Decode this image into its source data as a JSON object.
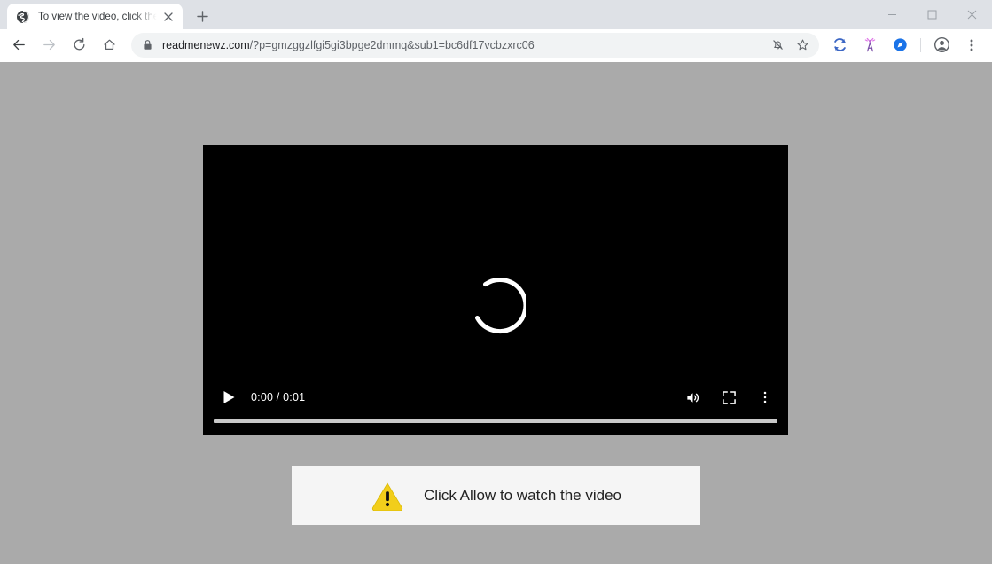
{
  "window": {
    "controls": [
      {
        "name": "minimize",
        "glyph": "minimize-icon"
      },
      {
        "name": "maximize",
        "glyph": "maximize-icon"
      },
      {
        "name": "close",
        "glyph": "close-icon"
      }
    ]
  },
  "tabstrip": {
    "tab": {
      "title": "To view the video, click the Allow",
      "favicon": "globe-icon",
      "close_label": "close-tab-icon"
    },
    "new_tab_label": "new-tab-icon"
  },
  "toolbar": {
    "back_label": "back-arrow-icon",
    "forward_label": "forward-arrow-icon",
    "reload_label": "reload-icon",
    "home_label": "home-icon",
    "lock_label": "lock-icon",
    "url_host": "readmenewz.com",
    "url_path": "/?p=gmzggzlfgi5gi3bpge2dmmq&sub1=bc6df17vcbzxrc06",
    "notifications_blocked_label": "bell-slash-icon",
    "bookmark_label": "star-icon",
    "extensions": [
      {
        "name": "sync-extension",
        "icon": "circular-arrows-icon",
        "color": "#3b66c4"
      },
      {
        "name": "antenna-extension",
        "icon": "antenna-tower-icon",
        "color": "#b06ad6"
      },
      {
        "name": "compass-extension",
        "icon": "compass-icon",
        "color": "#1a73e8"
      }
    ],
    "profile_label": "profile-avatar-icon",
    "menu_label": "chrome-menu-icon"
  },
  "page": {
    "background_color": "#aaaaaa",
    "video": {
      "background_color": "#000000",
      "spinner_label": "loading-spinner",
      "play_label": "play-icon",
      "time_current": "0:00",
      "time_separator": "/",
      "time_duration": "0:01",
      "time_display": "0:00 / 0:01",
      "volume_label": "volume-icon",
      "fullscreen_label": "fullscreen-icon",
      "more_options_label": "more-options-icon",
      "progress_percent": 0
    },
    "notice": {
      "icon": "warning-triangle-icon",
      "icon_color": "#f2ce1b",
      "text": "Click Allow to watch the video",
      "background_color": "#f5f5f5"
    }
  }
}
